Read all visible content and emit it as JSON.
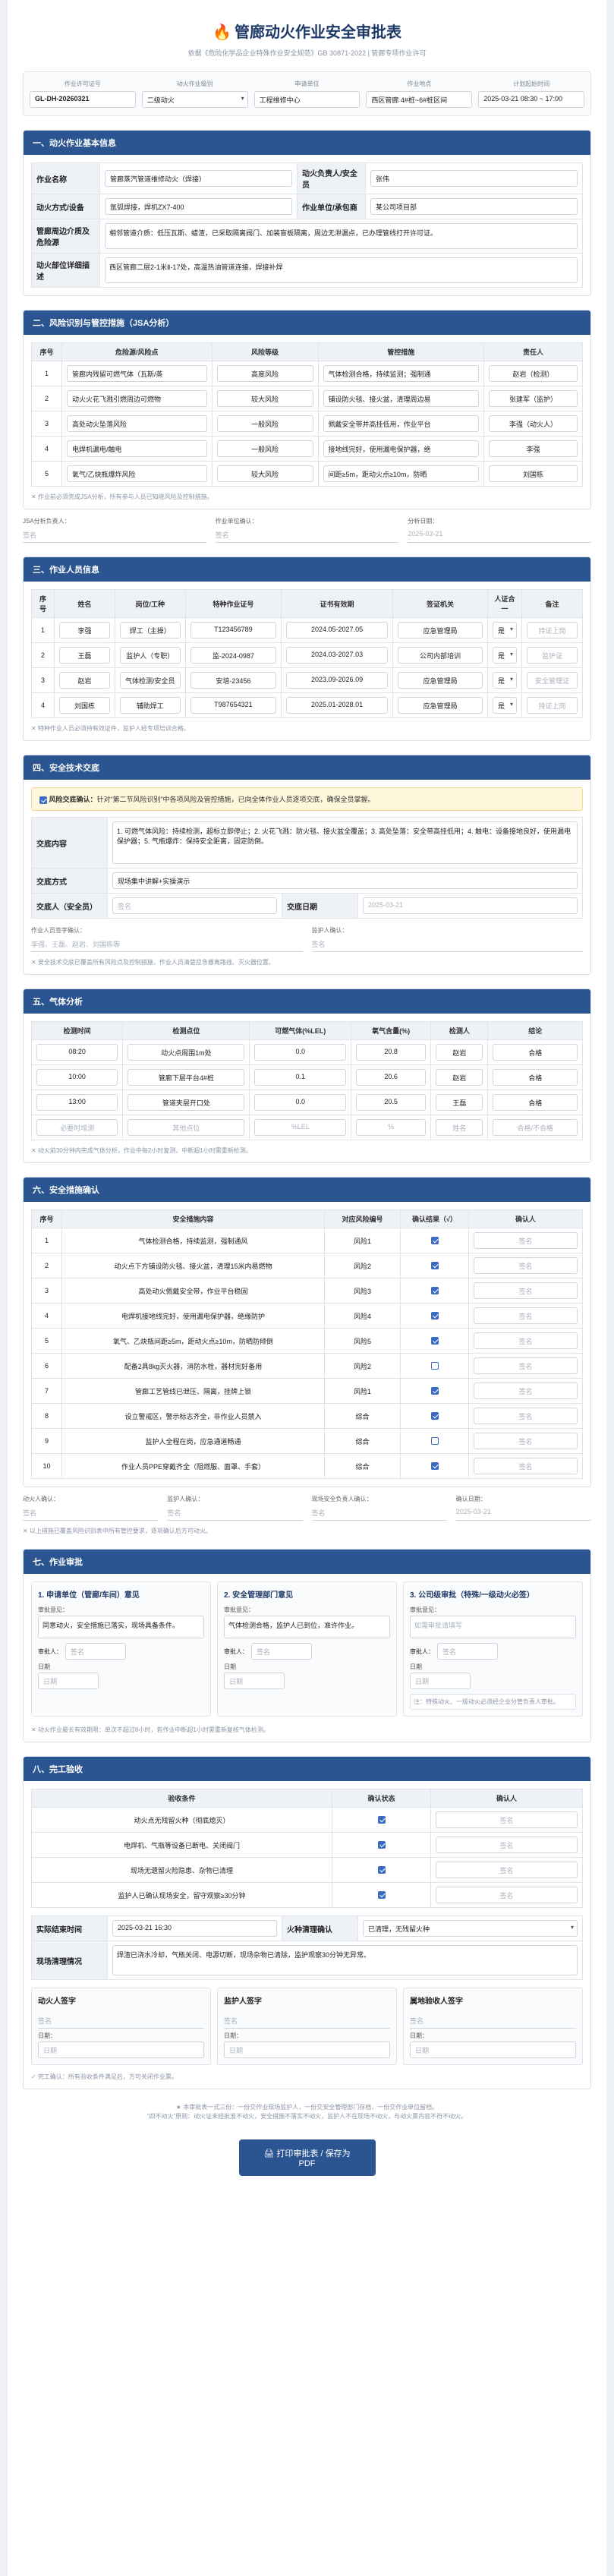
{
  "header": {
    "title": "管廊动火作业安全审批表",
    "subtitle": "依据《危险化学品企业特殊作业安全规范》GB 30871-2022 | 管廊专项作业许可"
  },
  "meta": [
    {
      "label": "作业许可证号",
      "value": "GL-DH-20260321"
    },
    {
      "label": "动火作业级别",
      "value": "二级动火"
    },
    {
      "label": "申请单位",
      "value": "工程维修中心"
    },
    {
      "label": "作业地点",
      "value": "西区管廊 4#桩~6#桩区间"
    },
    {
      "label": "计划起始时间",
      "value": "2025-03-21 08:30 ~ 17:00"
    }
  ],
  "s1": {
    "title": "一、动火作业基本信息",
    "rows": [
      {
        "l1": "作业名称",
        "v1": "管廊蒸汽管道维修动火（焊接）",
        "l2": "动火负责人/安全员",
        "v2": "张伟"
      },
      {
        "l1": "动火方式/设备",
        "v1": "氩弧焊接，焊机ZX7-400",
        "l2": "作业单位/承包商",
        "v2": "某公司项目部"
      }
    ],
    "r3_label": "管廊周边介质及危险源",
    "r3_value": "相邻管道介质：低压瓦斯、蜡渣，已采取隔离阀门、加装盲板隔离，周边无泄漏点，已办理管线打开许可证。",
    "r4_label": "动火部位详细描述",
    "r4_value": "西区管廊二层2-1米Ⅱ-17处，高温热油管道连接，焊接补焊"
  },
  "s2": {
    "title": "二、风险识别与管控措施（JSA分析）",
    "headers": [
      "序号",
      "危险源/风险点",
      "风险等级",
      "管控措施",
      "责任人"
    ],
    "rows": [
      [
        "1",
        "管廊内残留可燃气体（瓦斯/蒸",
        "高度风险",
        "气体检测合格，持续监测；强制通",
        "赵岩（检测）"
      ],
      [
        "2",
        "动火火花飞溅引燃周边可燃物",
        "较大风险",
        "铺设防火毯、接火盆，清理周边易",
        "张建军（监护）"
      ],
      [
        "3",
        "高处动火坠落风险",
        "一般风险",
        "佩戴安全带并高挂低用，作业平台",
        "李强（动火人）"
      ],
      [
        "4",
        "电焊机漏电/触电",
        "一般风险",
        "接地线完好，使用漏电保护器，绝",
        "李强"
      ],
      [
        "5",
        "氧气/乙炔瓶爆炸风险",
        "较大风险",
        "间距≥5m，距动火点≥10m，防晒",
        "刘国栋"
      ]
    ],
    "note": "✕ 作业前必须完成JSA分析，所有参与人员已知晓风险及控制措施。",
    "sig": [
      {
        "label": "JSA分析负责人：",
        "value": "签名"
      },
      {
        "label": "作业单位确认：",
        "value": "签名"
      },
      {
        "label": "分析日期：",
        "value": "2025-03-21"
      }
    ]
  },
  "s3": {
    "title": "三、作业人员信息",
    "headers": [
      "序号",
      "姓名",
      "岗位/工种",
      "特种作业证号",
      "证书有效期",
      "签证机关",
      "人证合一",
      "备注"
    ],
    "rows": [
      [
        "1",
        "李强",
        "焊工（主操）",
        "T123456789",
        "2024.05-2027.05",
        "应急管理局",
        "是",
        "持证上岗"
      ],
      [
        "2",
        "王磊",
        "监护人（专职）",
        "监-2024-0987",
        "2024.03-2027.03",
        "公司内部培训",
        "是",
        "监护证"
      ],
      [
        "3",
        "赵岩",
        "气体检测/安全员",
        "安培-23456",
        "2023.09-2026.09",
        "应急管理局",
        "是",
        "安全管理证"
      ],
      [
        "4",
        "刘国栋",
        "辅助焊工",
        "T987654321",
        "2025.01-2028.01",
        "应急管理局",
        "是",
        "持证上岗"
      ]
    ],
    "note": "✕ 特种作业人员必须持有效证件，监护人经专项培训合格。"
  },
  "s4": {
    "title": "四、安全技术交底",
    "alert_label": "风险交底确认：",
    "alert_text": "针对“第二节风险识别”中各项风险及管控措施，已向全体作业人员逐项交底，确保全员掌握。",
    "content_label": "交底内容",
    "content_text": "1. 可燃气体风险：持续检测，超标立即停止；2. 火花飞溅：防火毯、接火盆全覆盖；3. 高处坠落：安全带高挂低用；4. 触电：设备接地良好，使用漏电保护器；5. 气瓶爆炸：保持安全距离，固定防倒。",
    "method_label": "交底方式",
    "method_value": "现场集中讲解+实操演示",
    "person_label": "交底人（安全员）",
    "person_value": "签名",
    "date_label": "交底日期",
    "date_value": "2025-03-21",
    "recv_label": "作业人员签字确认：",
    "recv_value": "李强、王磊、赵岩、刘国栋等",
    "guard_label": "监护人确认：",
    "guard_value": "签名",
    "note": "✕ 安全技术交底已覆盖所有风险点及控制措施，作业人员清楚应急撤离路线、灭火器位置。"
  },
  "s5": {
    "title": "五、气体分析",
    "headers": [
      "检测时间",
      "检测点位",
      "可燃气体(%LEL)",
      "氧气含量(%)",
      "检测人",
      "结论"
    ],
    "rows": [
      [
        "08:20",
        "动火点周围1m处",
        "0.0",
        "20.8",
        "赵岩",
        "合格"
      ],
      [
        "10:00",
        "管廊下层平台4#桩",
        "0.1",
        "20.6",
        "赵岩",
        "合格"
      ],
      [
        "13:00",
        "管道夹层开口处",
        "0.0",
        "20.5",
        "王磊",
        "合格"
      ],
      [
        "必要时增测",
        "其他点位",
        "%LEL",
        "%",
        "姓名",
        "合格/不合格"
      ]
    ],
    "note": "✕ 动火前30分钟内完成气体分析，作业中每2小时复测，中断超1小时需重新检测。"
  },
  "s6": {
    "title": "六、安全措施确认",
    "headers": [
      "序号",
      "安全措施内容",
      "对应风险编号",
      "确认结果（√）",
      "确认人"
    ],
    "rows": [
      {
        "n": "1",
        "t": "气体检测合格，持续监测，强制通风",
        "r": "风险1",
        "c": true,
        "p": "签名"
      },
      {
        "n": "2",
        "t": "动火点下方铺设防火毯、接火盆，清理15米内易燃物",
        "r": "风险2",
        "c": true,
        "p": "签名"
      },
      {
        "n": "3",
        "t": "高处动火佩戴安全带，作业平台稳固",
        "r": "风险3",
        "c": true,
        "p": "签名"
      },
      {
        "n": "4",
        "t": "电焊机接地线完好，使用漏电保护器，绝缘防护",
        "r": "风险4",
        "c": true,
        "p": "签名"
      },
      {
        "n": "5",
        "t": "氧气、乙炔瓶间距≥5m，距动火点≥10m，防晒防倾倒",
        "r": "风险5",
        "c": true,
        "p": "签名"
      },
      {
        "n": "6",
        "t": "配备2具8kg灭火器，消防水栓，器材完好备用",
        "r": "风险2",
        "c": false,
        "p": "签名"
      },
      {
        "n": "7",
        "t": "管廊工艺管线已泄压、隔离，挂牌上锁",
        "r": "风险1",
        "c": true,
        "p": "签名"
      },
      {
        "n": "8",
        "t": "设立警戒区，警示标志齐全，非作业人员禁入",
        "r": "综合",
        "c": true,
        "p": "签名"
      },
      {
        "n": "9",
        "t": "监护人全程在岗，应急通道畅通",
        "r": "综合",
        "c": false,
        "p": "签名"
      },
      {
        "n": "10",
        "t": "作业人员PPE穿戴齐全（阻燃服、面罩、手套）",
        "r": "综合",
        "c": true,
        "p": "签名"
      }
    ],
    "sig": [
      {
        "label": "动火人确认：",
        "value": "签名"
      },
      {
        "label": "监护人确认：",
        "value": "签名"
      },
      {
        "label": "现场安全负责人确认：",
        "value": "签名"
      },
      {
        "label": "确认日期：",
        "value": "2025-03-21"
      }
    ],
    "note": "✕ 以上措施已覆盖风险识别表中所有管控要求，逐项确认后方可动火。"
  },
  "s7": {
    "title": "七、作业审批",
    "blocks": [
      {
        "h": "1. 申请单位（管廊/车间）意见",
        "ol": "审批意见：",
        "o": "同意动火，安全措施已落实，现场具备条件。",
        "sl": "审批人：",
        "s": "签名",
        "dl": "日期",
        "d": "日期"
      },
      {
        "h": "2. 安全管理部门意见",
        "ol": "审批意见：",
        "o": "气体检测合格，监护人已到位，准许作业。",
        "sl": "审批人：",
        "s": "签名",
        "dl": "日期",
        "d": "日期"
      },
      {
        "h": "3. 公司级审批（特殊/一级动火必签）",
        "ol": "审批意见：",
        "o": "如需审批请填写",
        "sl": "审批人：",
        "s": "签名",
        "dl": "日期",
        "d": "日期",
        "extra": "注：特殊动火、一级动火必须经企业分管负责人审批。"
      }
    ],
    "note": "✕ 动火作业最长有效期限：单次不超过8小时，若作业中断超1小时需重新复核气体检测。"
  },
  "s8": {
    "title": "八、完工验收",
    "headers": [
      "验收条件",
      "确认状态",
      "确认人"
    ],
    "rows": [
      {
        "t": "动火点无残留火种（彻底熄灭）",
        "c": true,
        "p": "签名"
      },
      {
        "t": "电焊机、气瓶等设备已断电、关闭阀门",
        "c": true,
        "p": "签名"
      },
      {
        "t": "现场无遗留火险隐患、杂物已清理",
        "c": true,
        "p": "签名"
      },
      {
        "t": "监护人已确认现场安全，留守观察≥30分钟",
        "c": true,
        "p": "签名"
      }
    ],
    "end_label": "实际结束时间",
    "end_value": "2025-03-21 16:30",
    "fire_label": "火种清理确认",
    "fire_value": "已清理，无残留火种",
    "desc_label": "现场清理情况",
    "desc_value": "焊渣已浇水冷却，气瓶关闭、电源切断，现场杂物已清除，监护观察30分钟无异常。",
    "sign_boxes": [
      {
        "h": "动火人签字",
        "s": "签名",
        "d": "日期"
      },
      {
        "h": "监护人签字",
        "s": "签名",
        "d": "日期"
      },
      {
        "h": "属地验收人签字",
        "s": "签名",
        "d": "日期"
      }
    ],
    "note": "✓ 完工确认：所有验收条件满足后，方可关闭作业票。"
  },
  "footer": {
    "note1": "★ 本审批表一式三份：一份交作业现场监护人，一份交安全管理部门存档，一份交作业单位留档。",
    "note2": "“四不动火”原则：动火证未经批准不动火，安全措施不落实不动火，监护人不在现场不动火，与动火票内容不符不动火。",
    "button": "打印审批表 / 保存为PDF"
  }
}
